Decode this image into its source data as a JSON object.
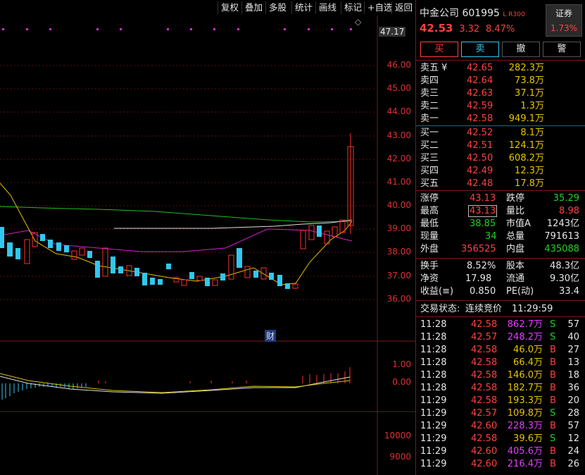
{
  "toolbar": {
    "buttons": [
      "复权",
      "叠加",
      "多股",
      "统计",
      "画线",
      "标记",
      "+自选",
      "返回"
    ]
  },
  "chart": {
    "price_axis": [
      "46.00",
      "45.00",
      "44.00",
      "43.00",
      "42.00",
      "41.00",
      "40.00",
      "39.00",
      "38.00",
      "37.00",
      "36.00"
    ],
    "last_price_tag": "47.17",
    "macd_axis": [
      "1.00",
      "0.00"
    ],
    "volume_axis": [
      "10000",
      "9000"
    ],
    "finance_marker": "财",
    "diamond_marker": "◇"
  },
  "header": {
    "name": "中金公司",
    "code": "601995",
    "badge": "L R300",
    "price": "42.53",
    "change": "3.32",
    "change_pct": "8.47%",
    "sector": "证券",
    "sector_pct": "1.73%"
  },
  "actions": [
    "买",
    "卖",
    "撤",
    "警"
  ],
  "sell_book": [
    {
      "label": "卖五 ¥",
      "price": "42.65",
      "vol": "282.3万"
    },
    {
      "label": "卖四",
      "price": "42.64",
      "vol": "73.8万"
    },
    {
      "label": "卖三",
      "price": "42.63",
      "vol": "37.1万"
    },
    {
      "label": "卖二",
      "price": "42.59",
      "vol": "1.3万"
    },
    {
      "label": "卖一",
      "price": "42.58",
      "vol": "949.1万"
    }
  ],
  "buy_book": [
    {
      "label": "买一",
      "price": "42.52",
      "vol": "8.1万"
    },
    {
      "label": "买二",
      "price": "42.51",
      "vol": "124.1万"
    },
    {
      "label": "买三",
      "price": "42.50",
      "vol": "608.2万"
    },
    {
      "label": "买四",
      "price": "42.49",
      "vol": "12.3万"
    },
    {
      "label": "买五",
      "price": "42.48",
      "vol": "17.8万"
    }
  ],
  "stats1": [
    {
      "l1": "涨停",
      "v1": "43.13",
      "c1": "red",
      "l2": "跌停",
      "v2": "35.29",
      "c2": "green"
    },
    {
      "l1": "最高",
      "v1": "43.13",
      "c1": "red",
      "l2": "量比",
      "v2": "8.98",
      "c2": "red"
    },
    {
      "l1": "最低",
      "v1": "38.85",
      "c1": "green",
      "l2": "市值A",
      "v2": "1243亿",
      "c2": "white"
    },
    {
      "l1": "现量",
      "v1": "34",
      "c1": "green",
      "l2": "总量",
      "v2": "791613",
      "c2": "white"
    },
    {
      "l1": "外盘",
      "v1": "356525",
      "c1": "red",
      "l2": "内盘",
      "v2": "435088",
      "c2": "green"
    }
  ],
  "stats2": [
    {
      "l1": "换手",
      "v1": "8.52%",
      "l2": "股本",
      "v2": "48.3亿"
    },
    {
      "l1": "净资",
      "v1": "17.98",
      "l2": "流通",
      "v2": "9.30亿"
    },
    {
      "l1": "收益(≡)",
      "v1": "0.850",
      "l2": "PE(动)",
      "v2": "33.4"
    }
  ],
  "status": {
    "label": "交易状态:",
    "value": "连续竞价",
    "time": "11:29:59"
  },
  "ticks": [
    {
      "t": "11:28",
      "p": "42.58",
      "v": "862.7万",
      "s": "S",
      "n": "57",
      "vc": "purple"
    },
    {
      "t": "11:28",
      "p": "42.57",
      "v": "248.2万",
      "s": "S",
      "n": "40",
      "vc": "purple"
    },
    {
      "t": "11:28",
      "p": "42.58",
      "v": "46.0万",
      "s": "B",
      "n": "27",
      "vc": "yellow"
    },
    {
      "t": "11:28",
      "p": "42.58",
      "v": "66.4万",
      "s": "B",
      "n": "13",
      "vc": "yellow"
    },
    {
      "t": "11:28",
      "p": "42.58",
      "v": "146.0万",
      "s": "B",
      "n": "18",
      "vc": "yellow"
    },
    {
      "t": "11:28",
      "p": "42.58",
      "v": "182.7万",
      "s": "B",
      "n": "36",
      "vc": "yellow"
    },
    {
      "t": "11:29",
      "p": "42.58",
      "v": "193.3万",
      "s": "B",
      "n": "20",
      "vc": "yellow"
    },
    {
      "t": "11:29",
      "p": "42.57",
      "v": "109.8万",
      "s": "S",
      "n": "28",
      "vc": "yellow"
    },
    {
      "t": "11:29",
      "p": "42.60",
      "v": "228.3万",
      "s": "B",
      "n": "57",
      "vc": "purple"
    },
    {
      "t": "11:29",
      "p": "42.58",
      "v": "39.6万",
      "s": "S",
      "n": "12",
      "vc": "yellow"
    },
    {
      "t": "11:29",
      "p": "42.60",
      "v": "405.6万",
      "s": "B",
      "n": "24",
      "vc": "purple"
    },
    {
      "t": "11:29",
      "p": "42.60",
      "v": "216.4万",
      "s": "B",
      "n": "26",
      "vc": "purple"
    }
  ]
}
